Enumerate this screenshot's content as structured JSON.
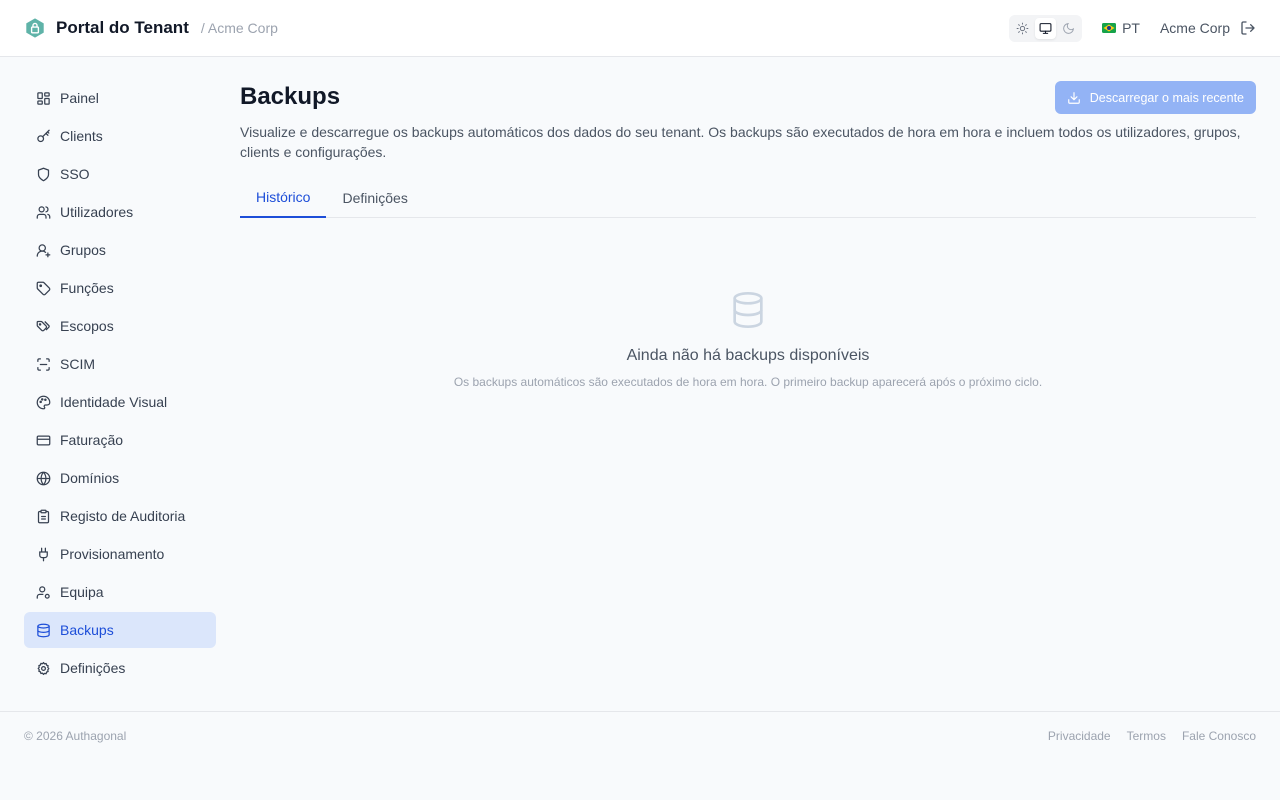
{
  "header": {
    "title": "Portal do Tenant",
    "breadcrumb": "/ Acme Corp",
    "theme_options": [
      "sun-icon",
      "monitor-icon",
      "moon-icon"
    ],
    "theme_selected": "monitor-icon",
    "language": "PT",
    "tenant_name": "Acme Corp"
  },
  "sidebar": {
    "items": [
      {
        "label": "Painel",
        "icon": "dashboard-icon"
      },
      {
        "label": "Clients",
        "icon": "key-icon"
      },
      {
        "label": "SSO",
        "icon": "shield-icon"
      },
      {
        "label": "Utilizadores",
        "icon": "users-icon"
      },
      {
        "label": "Grupos",
        "icon": "group-icon"
      },
      {
        "label": "Funções",
        "icon": "tag-icon"
      },
      {
        "label": "Escopos",
        "icon": "tags-icon"
      },
      {
        "label": "SCIM",
        "icon": "scan-icon"
      },
      {
        "label": "Identidade Visual",
        "icon": "palette-icon"
      },
      {
        "label": "Faturação",
        "icon": "credit-card-icon"
      },
      {
        "label": "Domínios",
        "icon": "globe-icon"
      },
      {
        "label": "Registo de Auditoria",
        "icon": "clipboard-icon"
      },
      {
        "label": "Provisionamento",
        "icon": "plug-icon"
      },
      {
        "label": "Equipa",
        "icon": "user-cog-icon"
      },
      {
        "label": "Backups",
        "icon": "database-icon",
        "active": true
      },
      {
        "label": "Definições",
        "icon": "gear-icon"
      }
    ]
  },
  "main": {
    "title": "Backups",
    "download_button": "Descarregar o mais recente",
    "description": "Visualize e descarregue os backups automáticos dos dados do seu tenant. Os backups são executados de hora em hora e incluem todos os utilizadores, grupos, clients e configurações.",
    "tabs": [
      {
        "label": "Histórico",
        "active": true
      },
      {
        "label": "Definições",
        "active": false
      }
    ],
    "empty_state": {
      "title": "Ainda não há backups disponíveis",
      "subtitle": "Os backups automáticos são executados de hora em hora. O primeiro backup aparecerá após o próximo ciclo."
    }
  },
  "footer": {
    "copyright": "© 2026 Authagonal",
    "links": [
      "Privacidade",
      "Termos",
      "Fale Conosco"
    ]
  },
  "colors": {
    "accent": "#1d4ed8",
    "active_nav_bg": "#dbe6fb",
    "button_bg": "#93b3f5",
    "logo": "#5fb3a8"
  }
}
